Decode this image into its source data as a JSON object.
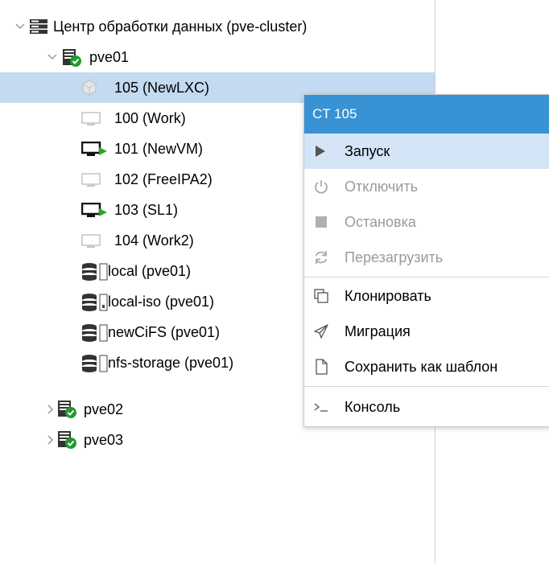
{
  "tree": {
    "datacenter_label": "Центр обработки данных (pve-cluster)",
    "node1": {
      "label": "pve01",
      "expanded": true
    },
    "items": [
      {
        "label": "105 (NewLXC)",
        "type": "lxc",
        "running": false,
        "selected": true
      },
      {
        "label": "100 (Work)",
        "type": "vm",
        "running": false
      },
      {
        "label": "101 (NewVM)",
        "type": "vm",
        "running": true
      },
      {
        "label": "102 (FreeIPA2)",
        "type": "vm",
        "running": false
      },
      {
        "label": "103 (SL1)",
        "type": "vm",
        "running": true
      },
      {
        "label": "104 (Work2)",
        "type": "vm",
        "running": false
      },
      {
        "label": "local (pve01)",
        "type": "storage"
      },
      {
        "label": "local-iso (pve01)",
        "type": "storage"
      },
      {
        "label": "newCiFS (pve01)",
        "type": "storage"
      },
      {
        "label": "nfs-storage (pve01)",
        "type": "storage"
      }
    ],
    "node2": {
      "label": "pve02",
      "expanded": false
    },
    "node3": {
      "label": "pve03",
      "expanded": false
    }
  },
  "context_menu": {
    "title": "CT 105",
    "items": [
      {
        "label": "Запуск",
        "icon": "play-icon",
        "disabled": false,
        "hover": true
      },
      {
        "label": "Отключить",
        "icon": "power-icon",
        "disabled": true
      },
      {
        "label": "Остановка",
        "icon": "stop-icon",
        "disabled": true
      },
      {
        "label": "Перезагрузить",
        "icon": "refresh-icon",
        "disabled": true
      },
      {
        "label": "Клонировать",
        "icon": "clone-icon",
        "disabled": false
      },
      {
        "label": "Миграция",
        "icon": "send-icon",
        "disabled": false
      },
      {
        "label": "Сохранить как шаблон",
        "icon": "file-icon",
        "disabled": false
      },
      {
        "label": "Консоль",
        "icon": "terminal-icon",
        "disabled": false
      }
    ]
  },
  "colors": {
    "selection": "#c3daf0",
    "menu_header": "#3892d4",
    "running_green": "#22aa22",
    "node_ok_green": "#1f9a2e"
  }
}
